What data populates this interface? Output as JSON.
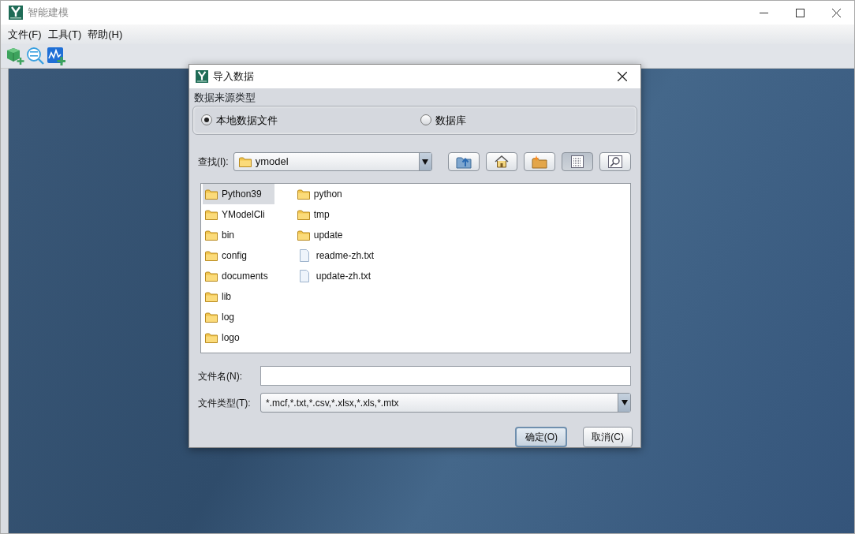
{
  "window": {
    "title": "智能建模",
    "menu": [
      "文件(F)",
      "工具(T)",
      "帮助(H)"
    ],
    "toolbar": [
      {
        "kind": "cube"
      },
      {
        "kind": "binary"
      },
      {
        "kind": "chart"
      }
    ]
  },
  "dialog": {
    "title": "导入数据",
    "source_group": {
      "label": "数据来源类型",
      "options": [
        {
          "label": "本地数据文件",
          "selected": true
        },
        {
          "label": "数据库",
          "selected": false
        }
      ]
    },
    "look_in": {
      "label": "查找(I):",
      "value": "ymodel"
    },
    "nav_buttons": [
      {
        "kind": "up",
        "selected": false
      },
      {
        "kind": "home",
        "selected": false
      },
      {
        "kind": "new-folder",
        "selected": false
      },
      {
        "kind": "list",
        "selected": true
      },
      {
        "kind": "details",
        "selected": false
      }
    ],
    "files": [
      {
        "name": "Python39",
        "kind": "folder",
        "selected": true
      },
      {
        "name": "YModelCli",
        "kind": "folder",
        "selected": false
      },
      {
        "name": "bin",
        "kind": "folder",
        "selected": false
      },
      {
        "name": "config",
        "kind": "folder",
        "selected": false
      },
      {
        "name": "documents",
        "kind": "folder",
        "selected": false
      },
      {
        "name": "lib",
        "kind": "folder",
        "selected": false
      },
      {
        "name": "log",
        "kind": "folder",
        "selected": false
      },
      {
        "name": "logo",
        "kind": "folder",
        "selected": false
      },
      {
        "name": "python",
        "kind": "folder",
        "selected": false
      },
      {
        "name": "tmp",
        "kind": "folder",
        "selected": false
      },
      {
        "name": "update",
        "kind": "folder",
        "selected": false
      },
      {
        "name": "readme-zh.txt",
        "kind": "file",
        "selected": false
      },
      {
        "name": "update-zh.txt",
        "kind": "file",
        "selected": false
      }
    ],
    "file_name": {
      "label": "文件名(N):"
    },
    "file_type": {
      "label": "文件类型(T):",
      "value": "*.mcf,*.txt,*.csv,*.xlsx,*.xls,*.mtx"
    },
    "buttons": [
      {
        "label": "确定(O)",
        "default": true
      },
      {
        "label": "取消(C)",
        "default": false
      }
    ]
  }
}
